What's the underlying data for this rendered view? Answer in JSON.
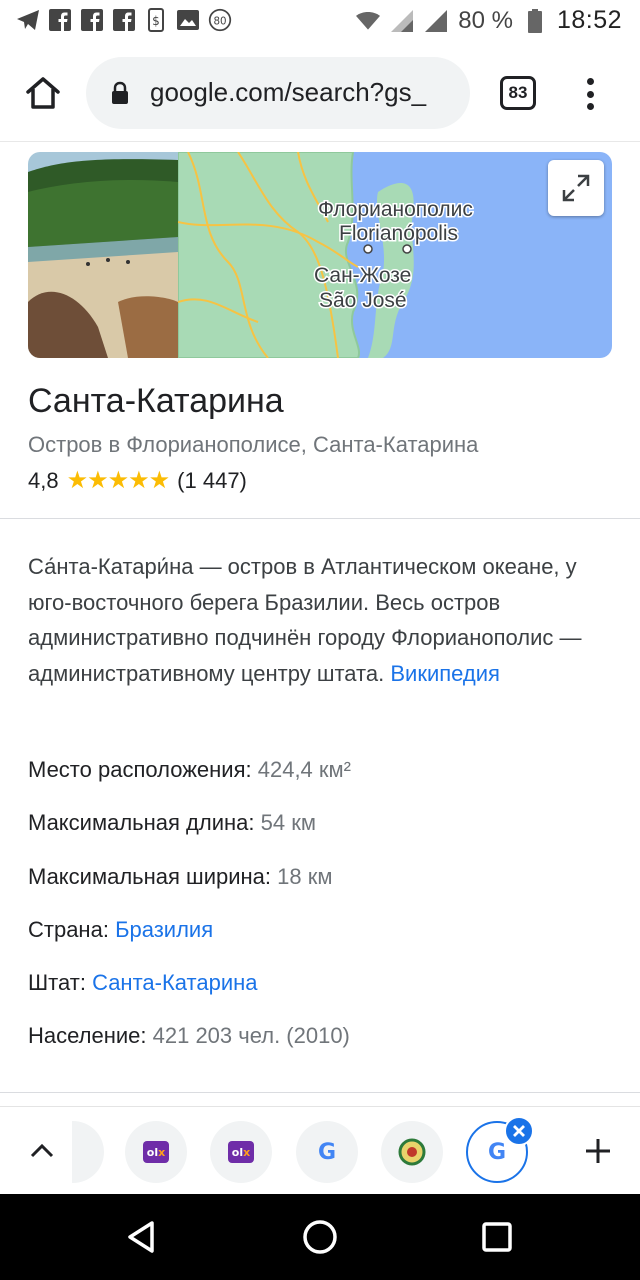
{
  "status_bar": {
    "battery": "80 %",
    "time": "18:52",
    "notification_icons": [
      "telegram-icon",
      "facebook-icon",
      "facebook-icon",
      "facebook-icon",
      "money-app-icon",
      "gallery-icon",
      "badge-80-icon"
    ],
    "badge_count": "80"
  },
  "browser": {
    "url_host": "google.com",
    "url_path": "/search?gs_",
    "tab_count": "83"
  },
  "map": {
    "label_city1_ru": "Флорианополис",
    "label_city1_pt": "Florianópolis",
    "label_city2_ru": "Сан-Жозе",
    "label_city2_pt": "São José"
  },
  "place": {
    "title": "Санта-Катарина",
    "subtitle": "Остров в Флорианополисе, Санта-Катарина",
    "rating": "4,8",
    "stars": "★★★★★",
    "reviews": "(1 447)",
    "rating_value": 4.8
  },
  "description": {
    "text": "Са́нта-Катари́на — остров в Атлантическом океане, у юго-восточного берега Бразилии. Весь остров административно подчинён городу Флорианополис — административному центру штата. ",
    "source_link": "Википедия"
  },
  "facts": [
    {
      "label": "Место расположения:",
      "value": "424,4 км²",
      "is_link": false
    },
    {
      "label": "Максимальная длина:",
      "value": "54 км",
      "is_link": false
    },
    {
      "label": "Максимальная ширина:",
      "value": "18 км",
      "is_link": false
    },
    {
      "label": "Страна:",
      "value": "Бразилия",
      "is_link": true
    },
    {
      "label": "Штат:",
      "value": "Санта-Катарина",
      "is_link": true
    },
    {
      "label": "Население:",
      "value": "421 203 чел. (2010)",
      "is_link": false
    }
  ],
  "tab_strip": {
    "olx_label_ol": "ol",
    "olx_label_x": "x",
    "google_label": "G",
    "tabs": [
      "olx-tab",
      "olx-tab",
      "google-tab",
      "emblem-tab",
      "google-tab-active"
    ]
  },
  "colors": {
    "link": "#1a73e8",
    "star": "#fbbc04",
    "map_water": "#8ab4f8",
    "map_land": "#a8dab5"
  }
}
